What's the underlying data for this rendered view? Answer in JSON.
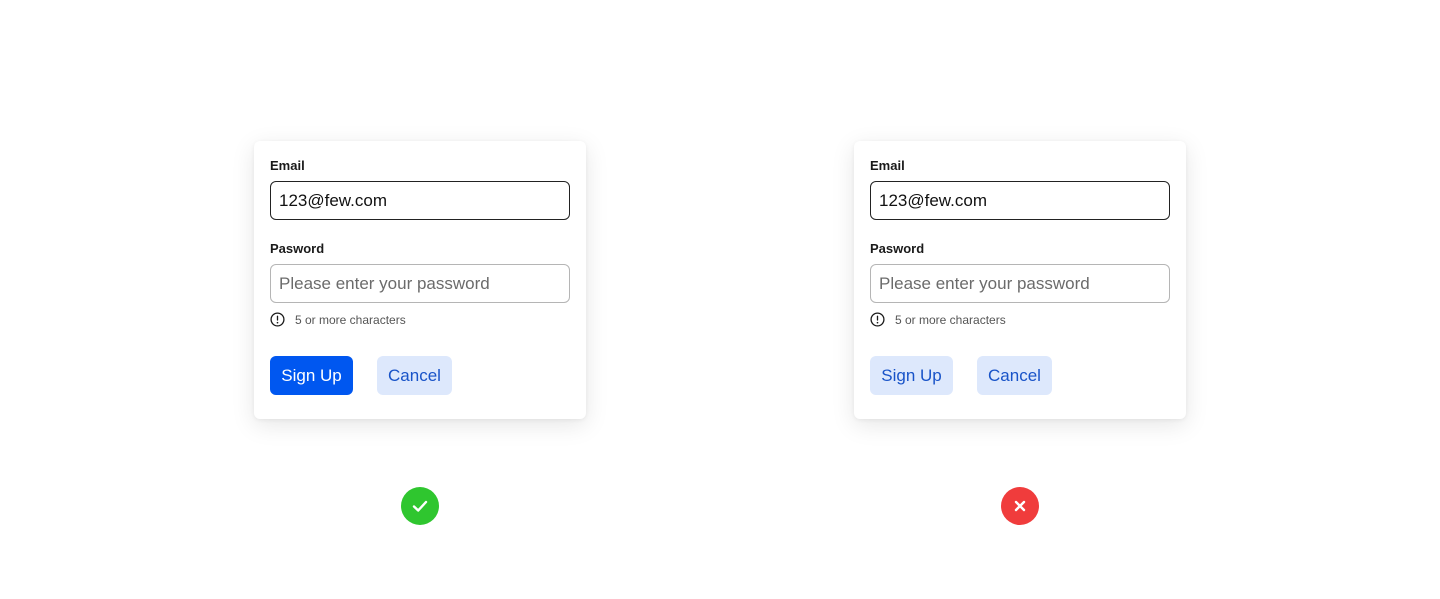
{
  "examples": [
    {
      "form": {
        "email_label": "Email",
        "email_value": "123@few.com",
        "password_label": "Pasword",
        "password_placeholder": "Please enter your password",
        "hint": "5 or more characters",
        "signup_label": "Sign Up",
        "cancel_label": "Cancel"
      },
      "verdict": "check-icon",
      "verdict_color": "#2fc62f",
      "primary_color": "#0057f0"
    },
    {
      "form": {
        "email_label": "Email",
        "email_value": "123@few.com",
        "password_label": "Pasword",
        "password_placeholder": "Please enter your password",
        "hint": "5 or more characters",
        "signup_label": "Sign Up",
        "cancel_label": "Cancel"
      },
      "verdict": "cross-icon",
      "verdict_color": "#f03c3c",
      "secondary_color": "#dde8fc"
    }
  ]
}
